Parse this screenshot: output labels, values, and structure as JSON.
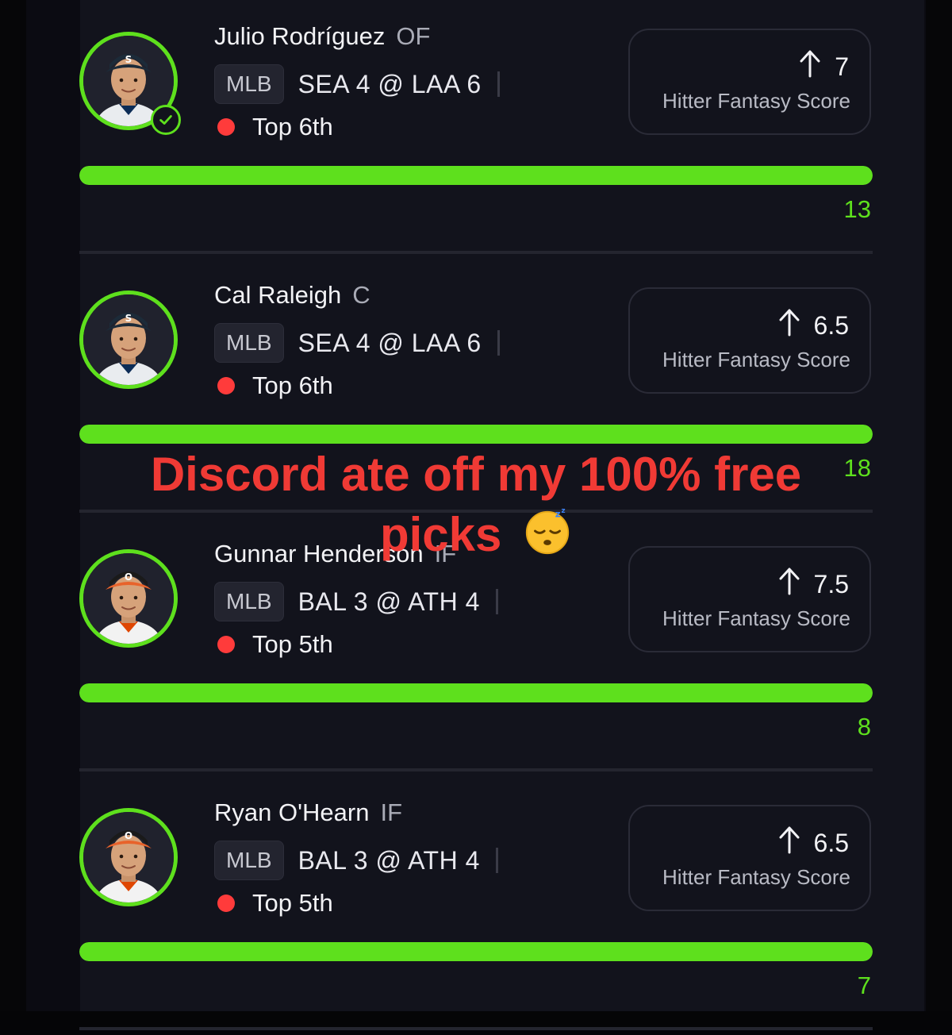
{
  "overlay": {
    "line1": "Discord ate off my 100% free",
    "line2": "picks",
    "emoji": "sleeping-face-emoji"
  },
  "colors": {
    "accent": "#5ee01d",
    "live": "#ff3b3b",
    "overlay_text": "#f03a35"
  },
  "cards": [
    {
      "name": "Julio Rodríguez",
      "position": "OF",
      "league": "MLB",
      "matchup": "SEA 4 @ LAA 6",
      "status": "Top 6th",
      "direction": "up",
      "line": "7",
      "stat_label": "Hitter Fantasy Score",
      "actual": "13",
      "progress_fraction": 1.0,
      "verified": true,
      "team_cap": "S"
    },
    {
      "name": "Cal Raleigh",
      "position": "C",
      "league": "MLB",
      "matchup": "SEA 4 @ LAA 6",
      "status": "Top 6th",
      "direction": "up",
      "line": "6.5",
      "stat_label": "Hitter Fantasy Score",
      "actual": "18",
      "progress_fraction": 1.0,
      "verified": false,
      "team_cap": "S"
    },
    {
      "name": "Gunnar Henderson",
      "position": "IF",
      "league": "MLB",
      "matchup": "BAL 3 @ ATH 4",
      "status": "Top 5th",
      "direction": "up",
      "line": "7.5",
      "stat_label": "Hitter Fantasy Score",
      "actual": "8",
      "progress_fraction": 1.0,
      "verified": false,
      "team_cap": "O"
    },
    {
      "name": "Ryan O'Hearn",
      "position": "IF",
      "league": "MLB",
      "matchup": "BAL 3 @ ATH 4",
      "status": "Top 5th",
      "direction": "up",
      "line": "6.5",
      "stat_label": "Hitter Fantasy Score",
      "actual": "7",
      "progress_fraction": 1.0,
      "verified": false,
      "team_cap": "O"
    }
  ]
}
